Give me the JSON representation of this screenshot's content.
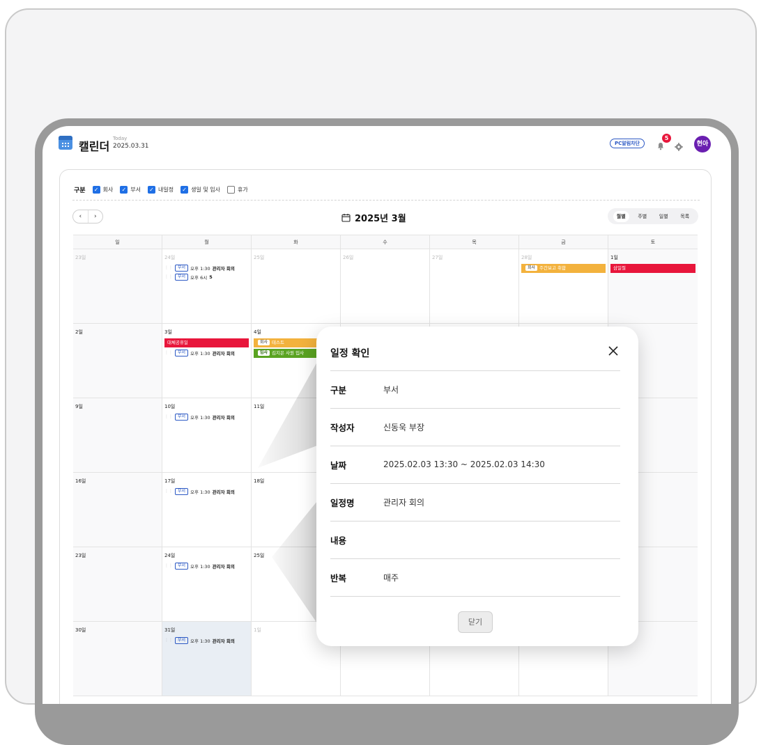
{
  "header": {
    "app_title": "캘린더",
    "today_label": "Today",
    "today_date": "2025.03.31",
    "pc_button": "PC알림차단",
    "notification_count": "5",
    "avatar_text": "현아",
    "accent_color": "#6a1fb0"
  },
  "filters": {
    "label": "구분",
    "items": [
      {
        "label": "회사",
        "checked": true
      },
      {
        "label": "부서",
        "checked": true
      },
      {
        "label": "내일정",
        "checked": true
      },
      {
        "label": "생일 및 입사",
        "checked": true
      },
      {
        "label": "휴가",
        "checked": false
      }
    ]
  },
  "calendar": {
    "prev": "‹",
    "next": "›",
    "month_title": "2025년 3월",
    "views": [
      "월별",
      "주별",
      "일별",
      "목록"
    ],
    "active_view": "월별",
    "weekdays": [
      "일",
      "월",
      "화",
      "수",
      "목",
      "금",
      "토"
    ],
    "weeks": [
      [
        {
          "day": "23일",
          "muted": true
        },
        {
          "day": "24일",
          "muted": true,
          "events": [
            {
              "kind": "line",
              "tag": "부서",
              "time": "오후 1:30",
              "title": "관리자 회의"
            },
            {
              "kind": "line",
              "tag": "부서",
              "time": "오후 6시",
              "title": "5"
            }
          ]
        },
        {
          "day": "25일",
          "muted": true
        },
        {
          "day": "26일",
          "muted": true
        },
        {
          "day": "27일",
          "muted": true
        },
        {
          "day": "28일",
          "muted": true,
          "events": [
            {
              "kind": "bar",
              "color": "orange",
              "tag": "회사",
              "title": "주간보고 취합"
            }
          ]
        },
        {
          "day": "1일",
          "events": [
            {
              "kind": "bar",
              "color": "red",
              "title": "삼일절"
            }
          ]
        }
      ],
      [
        {
          "day": "2일"
        },
        {
          "day": "3일",
          "events": [
            {
              "kind": "bar",
              "color": "red",
              "title": "대체공휴일"
            },
            {
              "kind": "line",
              "tag": "부서",
              "time": "오후 1:30",
              "title": "관리자 회의"
            }
          ]
        },
        {
          "day": "4일",
          "events": [
            {
              "kind": "bar",
              "color": "orange",
              "tag": "회사",
              "title": "테스트"
            },
            {
              "kind": "bar",
              "color": "green",
              "tag": "입사",
              "title": "김지은 사원 입사"
            }
          ]
        },
        {
          "day": ""
        },
        {
          "day": ""
        },
        {
          "day": ""
        },
        {
          "day": ""
        }
      ],
      [
        {
          "day": "9일"
        },
        {
          "day": "10일",
          "events": [
            {
              "kind": "line",
              "tag": "부서",
              "time": "오후 1:30",
              "title": "관리자 회의"
            }
          ]
        },
        {
          "day": "11일"
        },
        {
          "day": ""
        },
        {
          "day": ""
        },
        {
          "day": ""
        },
        {
          "day": ""
        }
      ],
      [
        {
          "day": "16일"
        },
        {
          "day": "17일",
          "events": [
            {
              "kind": "line",
              "tag": "부서",
              "time": "오후 1:30",
              "title": "관리자 회의"
            }
          ]
        },
        {
          "day": "18일"
        },
        {
          "day": ""
        },
        {
          "day": ""
        },
        {
          "day": ""
        },
        {
          "day": ""
        }
      ],
      [
        {
          "day": "23일"
        },
        {
          "day": "24일",
          "events": [
            {
              "kind": "line",
              "tag": "부서",
              "time": "오후 1:30",
              "title": "관리자 회의"
            }
          ]
        },
        {
          "day": "25일"
        },
        {
          "day": ""
        },
        {
          "day": ""
        },
        {
          "day": ""
        },
        {
          "day": ""
        }
      ],
      [
        {
          "day": "30일"
        },
        {
          "day": "31일",
          "today": true,
          "events": [
            {
              "kind": "line",
              "tag": "부서",
              "time": "오후 1:30",
              "title": "관리자 회의"
            }
          ]
        },
        {
          "day": "1일",
          "muted": true
        },
        {
          "day": ""
        },
        {
          "day": ""
        },
        {
          "day": ""
        },
        {
          "day": ""
        }
      ]
    ]
  },
  "modal": {
    "title": "일정 확인",
    "rows": [
      {
        "key": "구분",
        "value": "부서"
      },
      {
        "key": "작성자",
        "value": "신동욱 부장"
      },
      {
        "key": "날짜",
        "value": "2025.02.03 13:30 ~ 2025.02.03 14:30"
      },
      {
        "key": "일정명",
        "value": "관리자 회의"
      },
      {
        "key": "내용",
        "value": ""
      },
      {
        "key": "반복",
        "value": "매주"
      }
    ],
    "close_button": "닫기"
  }
}
